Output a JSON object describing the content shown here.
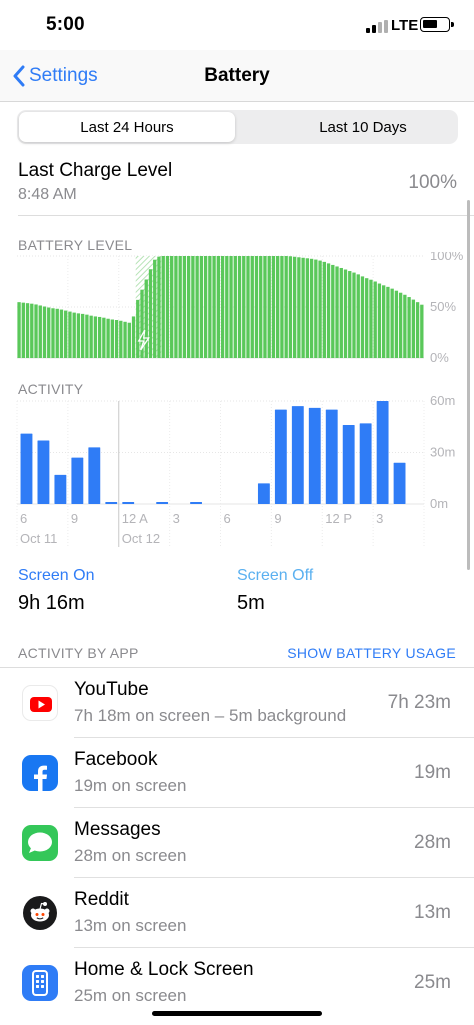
{
  "status_bar": {
    "time": "5:00",
    "carrier": "LTE"
  },
  "nav": {
    "back_label": "Settings",
    "title": "Battery"
  },
  "segmented": {
    "options": [
      "Last 24 Hours",
      "Last 10 Days"
    ],
    "selected": "Last 24 Hours"
  },
  "last_charge": {
    "title": "Last Charge Level",
    "time": "8:48 AM",
    "value": "100%"
  },
  "battery_level": {
    "label": "BATTERY LEVEL"
  },
  "activity": {
    "label": "ACTIVITY"
  },
  "screen": {
    "on_label": "Screen On",
    "on_value": "9h 16m",
    "off_label": "Screen Off",
    "off_value": "5m"
  },
  "activity_by_app": {
    "label": "ACTIVITY BY APP",
    "link": "SHOW BATTERY USAGE"
  },
  "apps": [
    {
      "name": "YouTube",
      "detail": "7h 18m on screen – 5m background",
      "time": "7h 23m",
      "icon": "youtube-icon"
    },
    {
      "name": "Facebook",
      "detail": "19m on screen",
      "time": "19m",
      "icon": "facebook-icon"
    },
    {
      "name": "Messages",
      "detail": "28m on screen",
      "time": "28m",
      "icon": "messages-icon"
    },
    {
      "name": "Reddit",
      "detail": "13m on screen",
      "time": "13m",
      "icon": "reddit-icon"
    },
    {
      "name": "Home & Lock Screen",
      "detail": "25m on screen",
      "time": "25m",
      "icon": "home-lock-screen-icon"
    }
  ],
  "colors": {
    "accent": "#2f7cf6",
    "battery_green": "#5ac85a",
    "charging_hatch": "#b6e3b6",
    "screen_on": "#2f7cf6",
    "screen_off": "#5ab0f0",
    "youtube": "#ff0000",
    "facebook": "#1877f2",
    "messages": "#34c759",
    "reddit": "#1a1a1b"
  },
  "chart_data": [
    {
      "type": "bar",
      "title": "BATTERY LEVEL",
      "y_tick_labels": [
        "100%",
        "50%",
        "0%"
      ],
      "ylim": [
        0,
        100
      ],
      "unit": "%",
      "x_range_hours": [
        0,
        24
      ],
      "charging_interval": [
        7,
        8.5
      ],
      "samples": [
        [
          0,
          55
        ],
        [
          0.5,
          54
        ],
        [
          1,
          53
        ],
        [
          1.5,
          51
        ],
        [
          2,
          49
        ],
        [
          2.5,
          48
        ],
        [
          3,
          46
        ],
        [
          3.5,
          44
        ],
        [
          4,
          43
        ],
        [
          4.5,
          41
        ],
        [
          5,
          40
        ],
        [
          5.5,
          38
        ],
        [
          6,
          37
        ],
        [
          6.5,
          35
        ],
        [
          6.8,
          34
        ],
        [
          7,
          52
        ],
        [
          7.3,
          64
        ],
        [
          7.6,
          76
        ],
        [
          7.9,
          88
        ],
        [
          8.1,
          96
        ],
        [
          8.3,
          99
        ],
        [
          8.5,
          100
        ],
        [
          9,
          100
        ],
        [
          9.5,
          100
        ],
        [
          10,
          100
        ],
        [
          10.5,
          100
        ],
        [
          11,
          100
        ],
        [
          11.5,
          100
        ],
        [
          12,
          100
        ],
        [
          12.5,
          100
        ],
        [
          13,
          100
        ],
        [
          13.5,
          100
        ],
        [
          14,
          100
        ],
        [
          14.5,
          100
        ],
        [
          15,
          100
        ],
        [
          15.5,
          100
        ],
        [
          16,
          100
        ],
        [
          16.5,
          99
        ],
        [
          17,
          98
        ],
        [
          17.5,
          97
        ],
        [
          18,
          95
        ],
        [
          18.5,
          92
        ],
        [
          19,
          89
        ],
        [
          19.5,
          86
        ],
        [
          20,
          83
        ],
        [
          20.5,
          79
        ],
        [
          21,
          76
        ],
        [
          21.5,
          72
        ],
        [
          22,
          69
        ],
        [
          22.5,
          65
        ],
        [
          23,
          61
        ],
        [
          23.5,
          56
        ],
        [
          24,
          51
        ]
      ]
    },
    {
      "type": "bar",
      "title": "ACTIVITY",
      "categories": [
        "6",
        "7",
        "8",
        "9",
        "10",
        "11",
        "12 A",
        "1",
        "2",
        "3",
        "4",
        "5",
        "6",
        "7",
        "8",
        "9",
        "10",
        "11",
        "12 P",
        "1",
        "2",
        "3",
        "4"
      ],
      "x_tick_labels": [
        "6",
        "9",
        "12 A",
        "3",
        "6",
        "9",
        "12 P",
        "3"
      ],
      "date_labels": [
        "Oct 11",
        "Oct 12"
      ],
      "y_tick_labels": [
        "60m",
        "30m",
        "0m"
      ],
      "ylim": [
        0,
        60
      ],
      "unit": "minutes",
      "series": [
        {
          "name": "Screen On",
          "values": [
            41,
            37,
            17,
            27,
            33,
            1,
            1,
            0,
            1,
            0,
            1,
            0,
            0,
            0,
            12,
            55,
            57,
            56,
            55,
            46,
            47,
            60,
            24
          ]
        }
      ]
    }
  ]
}
